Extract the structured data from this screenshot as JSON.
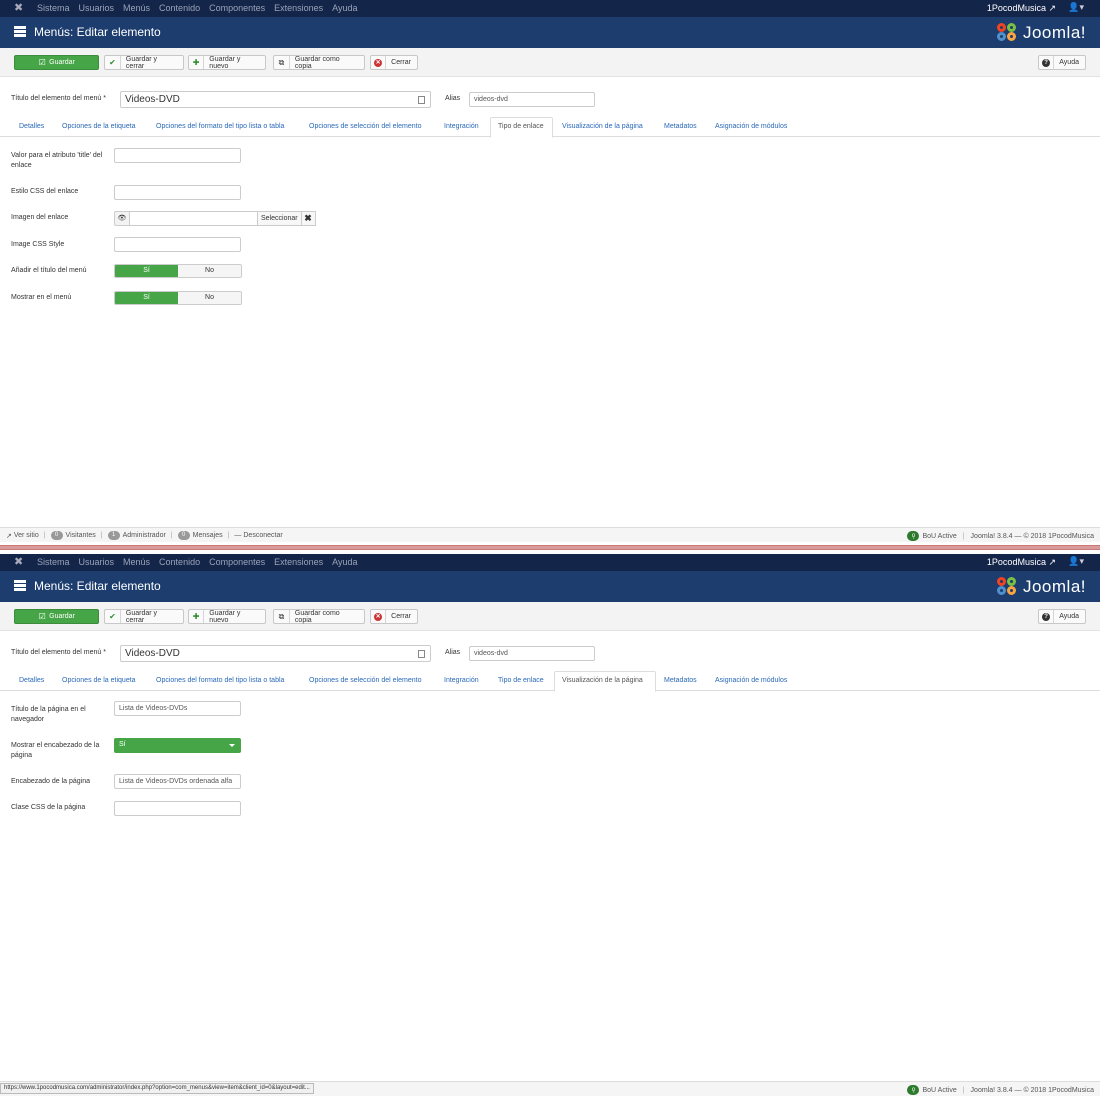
{
  "topnav": {
    "menu": [
      "Sistema",
      "Usuarios",
      "Menús",
      "Contenido",
      "Componentes",
      "Extensiones",
      "Ayuda"
    ],
    "site": "1PocodMusica ↗"
  },
  "header": {
    "title": "Menús: Editar elemento",
    "logo": "Joomla!"
  },
  "toolbar": {
    "save": "Guardar",
    "save_close": "Guardar y cerrar",
    "save_new": "Guardar y nuevo",
    "save_copy": "Guardar como copia",
    "close": "Cerrar",
    "help": "Ayuda"
  },
  "form": {
    "title_label": "Título del elemento del menú *",
    "title_value": "Videos-DVD",
    "alias_label": "Alias",
    "alias_value": "videos-dvd"
  },
  "tabs": [
    "Detalles",
    "Opciones de la etiqueta",
    "Opciones del formato del tipo lista o tabla",
    "Opciones de selección del elemento",
    "Integración",
    "Tipo de enlace",
    "Visualización de la página",
    "Metadatos",
    "Asignación de módulos"
  ],
  "link_type": {
    "title_attr_label": "Valor para el atributo 'title' del enlace",
    "css_style_label": "Estilo CSS del enlace",
    "image_label": "Imagen del enlace",
    "select_label": "Seleccionar",
    "image_css_label": "Image CSS Style",
    "add_title_label": "Añadir el título del menú",
    "show_menu_label": "Mostrar en el menú",
    "yes": "Sí",
    "no": "No"
  },
  "page_display": {
    "browser_title_label": "Título de la página en el navegador",
    "browser_title_value": "Lista de Videos-DVDs",
    "show_heading_label": "Mostrar el encabezado de la página",
    "show_heading_value": "Sí",
    "heading_label": "Encabezado de la página",
    "heading_value": "Lista de Videos-DVDs ordenada alfa",
    "css_class_label": "Clase CSS de la página"
  },
  "status": {
    "view_site": "Ver sitio",
    "visitors_count": "0",
    "visitors": "Visitantes",
    "admins_count": "1",
    "admins": "Administrador",
    "messages_count": "0",
    "messages": "Mensajes",
    "logout": "Desconectar",
    "bou": "BoU Active",
    "version": "Joomla! 3.8.4 — © 2018 1PocodMusica",
    "url": "https://www.1pocodmusica.com/administrator/index.php?option=com_menus&view=item&client_id=0&layout=edit..."
  }
}
